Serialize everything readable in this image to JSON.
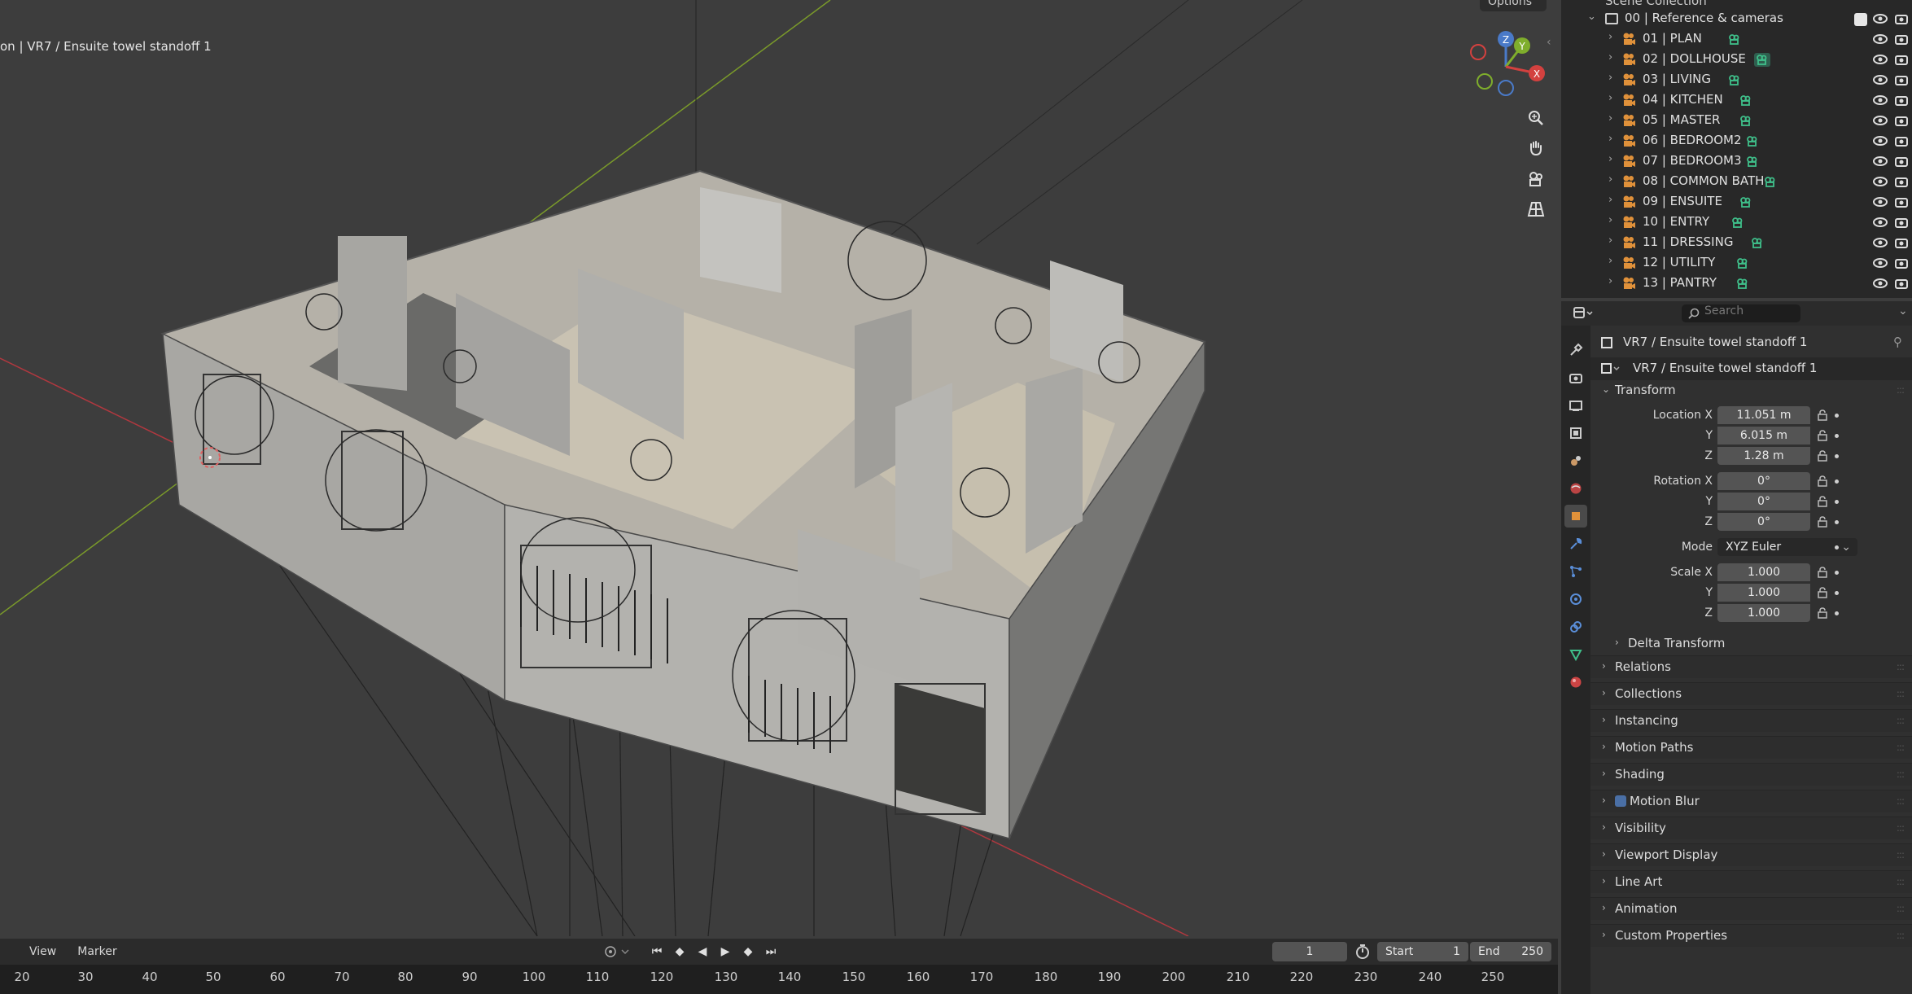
{
  "viewport": {
    "title": "on | VR7 / Ensuite towel standoff 1",
    "options_label": "Options",
    "gizmo": {
      "z": "Z",
      "y": "Y",
      "x": "X"
    },
    "nav_icons": [
      "zoom-icon",
      "hand-icon",
      "camera-view-icon",
      "grid-view-icon"
    ]
  },
  "timeline": {
    "menus": [
      "View",
      "Marker"
    ],
    "current_frame": "1",
    "start_label": "Start",
    "start_value": "1",
    "end_label": "End",
    "end_value": "250",
    "ruler_ticks": [
      "20",
      "30",
      "40",
      "50",
      "60",
      "70",
      "80",
      "90",
      "100",
      "110",
      "120",
      "130",
      "140",
      "150",
      "160",
      "170",
      "180",
      "190",
      "200",
      "210",
      "220",
      "230",
      "240",
      "250"
    ]
  },
  "outliner": {
    "header": "Scene Collection",
    "collection": "00 | Reference & cameras",
    "items": [
      "01 | PLAN",
      "02 | DOLLHOUSE",
      "03 | LIVING",
      "04 | KITCHEN",
      "05 | MASTER",
      "06 | BEDROOM2",
      "07 | BEDROOM3",
      "08 | COMMON BATH",
      "09 | ENSUITE",
      "10 | ENTRY",
      "11 | DRESSING",
      "12 | UTILITY",
      "13 | PANTRY"
    ],
    "accent_color": "#3fbf8a",
    "cam_color": "#e0913a"
  },
  "properties": {
    "search_placeholder": "Search",
    "object_name": "VR7 / Ensuite towel standoff 1",
    "data_name": "VR7 / Ensuite towel standoff 1",
    "transform_label": "Transform",
    "location_label": "Location X",
    "location": [
      "11.051 m",
      "6.015 m",
      "1.28 m"
    ],
    "rotation_label": "Rotation X",
    "rotation": [
      "0°",
      "0°",
      "0°"
    ],
    "mode_label": "Mode",
    "mode_value": "XYZ Euler",
    "scale_label": "Scale X",
    "scale": [
      "1.000",
      "1.000",
      "1.000"
    ],
    "axis_y": "Y",
    "axis_z": "Z",
    "delta_label": "Delta Transform",
    "sections": [
      "Relations",
      "Collections",
      "Instancing",
      "Motion Paths",
      "Shading",
      "Motion Blur",
      "Visibility",
      "Viewport Display",
      "Line Art",
      "Animation",
      "Custom Properties"
    ]
  }
}
